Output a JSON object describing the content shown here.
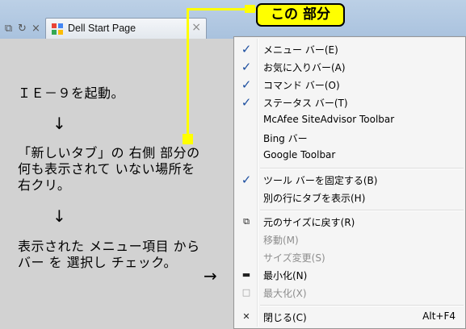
{
  "browser": {
    "tab_title": "Dell Start Page",
    "tab_close": "×",
    "nav_glyphs": [
      "⧉",
      "↻",
      "×"
    ]
  },
  "annotation": {
    "callout": "この 部分",
    "step1": "ＩＥ－９を起動。",
    "step2": "「新しいタブ」の 右側 部分の\n何も表示されて いない場所を\n右クリ。",
    "step3": "表示された メニュー項目 から\nバー を 選択し チェック。",
    "arrow_down": "↓",
    "arrow_right": "→"
  },
  "menu": {
    "toolbar_items": [
      {
        "label": "メニュー バー(E)",
        "checked": true
      },
      {
        "label": "お気に入りバー(A)",
        "checked": true
      },
      {
        "label": "コマンド バー(O)",
        "checked": true
      },
      {
        "label": "ステータス バー(T)",
        "checked": true
      },
      {
        "label": "McAfee SiteAdvisor Toolbar",
        "checked": false
      },
      {
        "label": "Bing バー",
        "checked": false
      },
      {
        "label": "Google Toolbar",
        "checked": false
      }
    ],
    "tab_items": [
      {
        "label": "ツール バーを固定する(B)",
        "checked": true
      },
      {
        "label": "別の行にタブを表示(H)",
        "checked": false
      }
    ],
    "window_items": [
      {
        "label": "元のサイズに戻す(R)",
        "icon": "⧉",
        "enabled": true
      },
      {
        "label": "移動(M)",
        "icon": "",
        "enabled": false
      },
      {
        "label": "サイズ変更(S)",
        "icon": "",
        "enabled": false
      },
      {
        "label": "最小化(N)",
        "icon": "▬",
        "enabled": true
      },
      {
        "label": "最大化(X)",
        "icon": "□",
        "enabled": false
      }
    ],
    "close_item": {
      "label": "閉じる(C)",
      "icon": "✕",
      "shortcut": "Alt+F4"
    },
    "check_glyph": "✓"
  },
  "colors": {
    "callout_bg": "#ffff00",
    "check": "#1d4fa0",
    "disabled_text": "#8d8d8d"
  }
}
